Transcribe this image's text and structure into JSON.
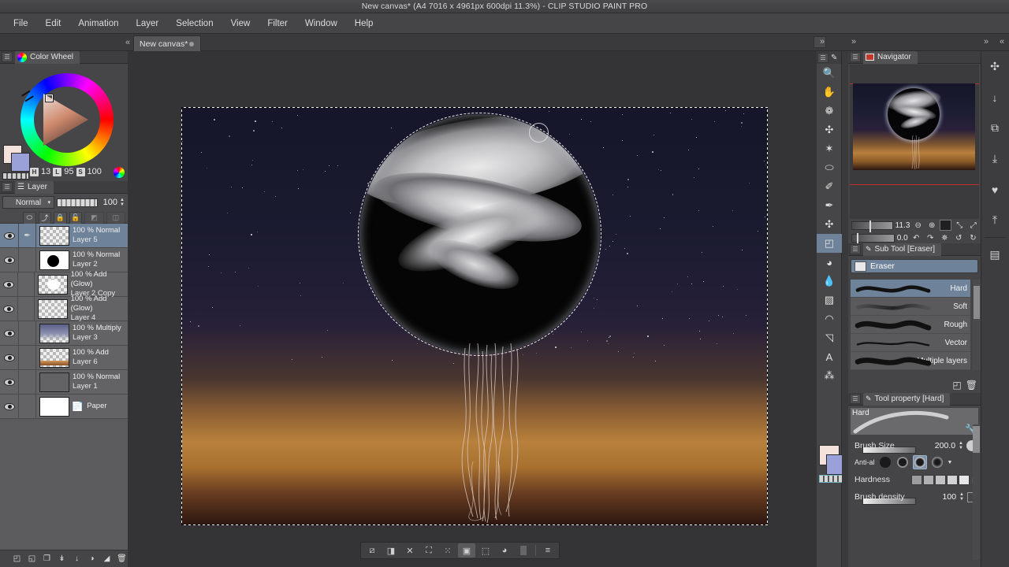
{
  "window": {
    "title": "New canvas* (A4 7016 x 4961px 600dpi 11.3%)  - CLIP STUDIO PAINT PRO"
  },
  "menubar": {
    "items": [
      {
        "label": "File"
      },
      {
        "label": "Edit"
      },
      {
        "label": "Animation"
      },
      {
        "label": "Layer"
      },
      {
        "label": "Selection"
      },
      {
        "label": "View"
      },
      {
        "label": "Filter"
      },
      {
        "label": "Window"
      },
      {
        "label": "Help"
      }
    ]
  },
  "tabbar": {
    "collapse_icon": "«",
    "tab_label": "New canvas*",
    "chevron_right": "»",
    "chevron_left": "«"
  },
  "color_wheel": {
    "title": "Color Wheel",
    "grip_icon": "grip-icon",
    "h_label": "H",
    "h_value": "13",
    "l_label": "L",
    "l_value": "95",
    "s_label": "S",
    "s_value": "100",
    "foreground_color": "#f3e2db",
    "background_color": "#9aa0d8"
  },
  "layer_panel": {
    "title": "Layer",
    "blend_mode": "Normal",
    "blend_chevron": "▾",
    "opacity": "100",
    "toolbar_icons": [
      {
        "name": "clip-to-layer-icon",
        "glyph": "⬭"
      },
      {
        "name": "ruler-lock-icon",
        "glyph": "⤴"
      },
      {
        "name": "lock-layer-icon",
        "glyph": "🔒"
      },
      {
        "name": "lock-transparency-icon",
        "glyph": "🔓"
      },
      {
        "name": "mask-enable-icon",
        "glyph": "◩"
      },
      {
        "name": "mask-settings-icon",
        "glyph": "◫"
      }
    ],
    "layers": [
      {
        "blend": "100 % Normal",
        "name": "Layer 5",
        "selected": true,
        "visible": true,
        "has_pen": true,
        "thumb": "transparent"
      },
      {
        "blend": "100 % Normal",
        "name": "Layer 2",
        "selected": false,
        "visible": true,
        "has_pen": false,
        "thumb": "black-circle"
      },
      {
        "blend": "100 % Add (Glow)",
        "name": "Layer 2 Copy",
        "selected": false,
        "visible": true,
        "has_pen": false,
        "thumb": "white-blob"
      },
      {
        "blend": "100 % Add (Glow)",
        "name": "Layer 4",
        "selected": false,
        "visible": true,
        "has_pen": false,
        "thumb": "transparent"
      },
      {
        "blend": "100 % Multiply",
        "name": "Layer 3",
        "selected": false,
        "visible": true,
        "has_pen": false,
        "thumb": "blue-gradient"
      },
      {
        "blend": "100 % Add",
        "name": "Layer 6",
        "selected": false,
        "visible": true,
        "has_pen": false,
        "thumb": "orange-strip"
      },
      {
        "blend": "100 % Normal",
        "name": "Layer 1",
        "selected": false,
        "visible": true,
        "has_pen": false,
        "thumb": "night-sky"
      },
      {
        "blend": "",
        "name": "Paper",
        "selected": false,
        "visible": true,
        "has_pen": false,
        "thumb": "white"
      }
    ],
    "bottom_icons": [
      {
        "name": "new-raster-layer-icon",
        "glyph": "◰"
      },
      {
        "name": "new-layer-folder-icon",
        "glyph": "◱"
      },
      {
        "name": "duplicate-layer-icon",
        "glyph": "❐"
      },
      {
        "name": "transfer-down-icon",
        "glyph": "↡"
      },
      {
        "name": "combine-down-icon",
        "glyph": "↓"
      },
      {
        "name": "layer-mask-icon",
        "glyph": "◑"
      },
      {
        "name": "clip-mask-icon",
        "glyph": "◢"
      },
      {
        "name": "delete-layer-icon",
        "glyph": "🗑"
      }
    ]
  },
  "tool_palette": {
    "tools": [
      {
        "name": "zoom-tool",
        "glyph": "🔍",
        "selected": false
      },
      {
        "name": "hand-tool",
        "glyph": "✋",
        "selected": false
      },
      {
        "name": "rotate-tool",
        "glyph": "❁",
        "selected": false
      },
      {
        "name": "move-layer-tool",
        "glyph": "✣",
        "selected": false
      },
      {
        "name": "select-tool",
        "glyph": "✶",
        "selected": false
      },
      {
        "name": "ellipse-select-tool",
        "glyph": "⬭",
        "selected": false
      },
      {
        "name": "eyedropper-tool",
        "glyph": "✐",
        "selected": false
      },
      {
        "name": "pen-tool",
        "glyph": "✒",
        "selected": false
      },
      {
        "name": "figure-tool",
        "glyph": "✣",
        "selected": false
      },
      {
        "name": "eraser-tool",
        "glyph": "◰",
        "selected": true
      },
      {
        "name": "fill-tool",
        "glyph": "◕",
        "selected": false
      },
      {
        "name": "blend-tool",
        "glyph": "💧",
        "selected": false
      },
      {
        "name": "gradient-tool",
        "glyph": "▨",
        "selected": false
      },
      {
        "name": "decoration-tool",
        "glyph": "◠",
        "selected": false
      },
      {
        "name": "ruler-tool",
        "glyph": "◹",
        "selected": false
      },
      {
        "name": "text-tool",
        "glyph": "A",
        "selected": false
      },
      {
        "name": "balloon-tool",
        "glyph": "⁂",
        "selected": false
      }
    ]
  },
  "navigator": {
    "title": "Navigator",
    "zoom_value": "11.3",
    "rotation_value": "0.0",
    "buttons": [
      {
        "name": "zoom-out-button",
        "glyph": "⊖"
      },
      {
        "name": "zoom-in-button",
        "glyph": "⊕"
      },
      {
        "name": "fit-to-screen-button",
        "glyph": "■"
      },
      {
        "name": "flip-horizontal-button",
        "glyph": "⤡"
      },
      {
        "name": "flip-vertical-button",
        "glyph": "⤢"
      },
      {
        "name": "rotate-left-button",
        "glyph": "↶"
      },
      {
        "name": "rotate-right-button",
        "glyph": "↷"
      },
      {
        "name": "reset-rotation-button",
        "glyph": "✵"
      },
      {
        "name": "rotate-ccw-button",
        "glyph": "↺"
      },
      {
        "name": "rotate-cw-button",
        "glyph": "↻"
      }
    ]
  },
  "sub_tool": {
    "title": "Sub Tool [Eraser]",
    "selected_tool": "Eraser",
    "items": [
      {
        "label": "Hard",
        "selected": true
      },
      {
        "label": "Soft",
        "selected": false
      },
      {
        "label": "Rough",
        "selected": false
      },
      {
        "label": "Vector",
        "selected": false
      },
      {
        "label": "Multiple layers",
        "selected": false
      }
    ],
    "bottom_icons": [
      {
        "name": "new-subtool-icon",
        "glyph": "◰"
      },
      {
        "name": "delete-subtool-icon",
        "glyph": "🗑"
      }
    ]
  },
  "tool_property": {
    "title": "Tool property [Hard]",
    "preview_label": "Hard",
    "wrench_icon": "wrench-icon",
    "brush_size_label": "Brush Size",
    "brush_size_value": "200.0",
    "antialias_label": "Anti-al",
    "antialias_selected_index": 2,
    "hardness_label": "Hardness",
    "brush_density_label": "Brush density",
    "brush_density_value": "100"
  },
  "selection_launcher": {
    "icons": [
      {
        "name": "cancel-selection-icon",
        "glyph": "⧄"
      },
      {
        "name": "invert-selection-icon",
        "glyph": "◨"
      },
      {
        "name": "shrink-selection-icon",
        "glyph": "✕"
      },
      {
        "name": "expand-selection-icon",
        "glyph": "⛶"
      },
      {
        "name": "select-border-icon",
        "glyph": "⁙"
      },
      {
        "name": "crop-selection-icon",
        "glyph": "▣"
      },
      {
        "name": "scale-selection-icon",
        "glyph": "⬚"
      },
      {
        "name": "fill-selection-icon",
        "glyph": "◕"
      },
      {
        "name": "screen-tone-icon",
        "glyph": "▒"
      },
      {
        "name": "launcher-drag-handle",
        "glyph": "≡"
      }
    ]
  },
  "quick_access": {
    "icons": [
      {
        "name": "folder-move-icon",
        "glyph": "✣"
      },
      {
        "name": "folder-down-icon",
        "glyph": "↓"
      },
      {
        "name": "folder-copy-icon",
        "glyph": "⧉"
      },
      {
        "name": "folder-import-icon",
        "glyph": "⤓"
      },
      {
        "name": "folder-favorite-icon",
        "glyph": "♥"
      },
      {
        "name": "folder-export-icon",
        "glyph": "⤒"
      },
      {
        "name": "folder-page-icon",
        "glyph": "▤"
      }
    ]
  },
  "canvas": {
    "artwork_description": "night sky with glowing jellyfish moon and sunset horizon",
    "sky_top_color": "#16162a",
    "horizon_color": "#b8803c",
    "moon_color": "#050505",
    "selection_active": true
  }
}
